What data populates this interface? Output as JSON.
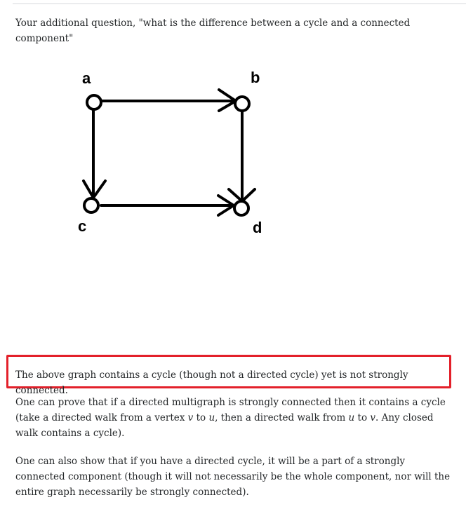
{
  "intro_text": "Your additional question, \"what is the difference between a cycle and a connected component\"",
  "graph": {
    "nodes": {
      "a": "a",
      "b": "b",
      "c": "c",
      "d": "d"
    }
  },
  "highlight_text": "The above graph contains a cycle (though not a directed cycle) yet is not strongly connected.",
  "prove_paragraph": {
    "part1": "One can prove that if a directed multigraph is strongly connected then it contains a cycle (take a directed walk from a vertex ",
    "v1": "v",
    "part2": " to ",
    "u1": "u",
    "part3": ", then a directed walk from ",
    "u2": "u",
    "part4": " to ",
    "v2": "v",
    "part5": ". Any closed walk contains a cycle)."
  },
  "show_paragraph": "One can also show that if you have a directed cycle, it will be a part of a strongly connected component (though it will not necessarily be the whole component, nor will the entire graph necessarily be strongly connected)."
}
